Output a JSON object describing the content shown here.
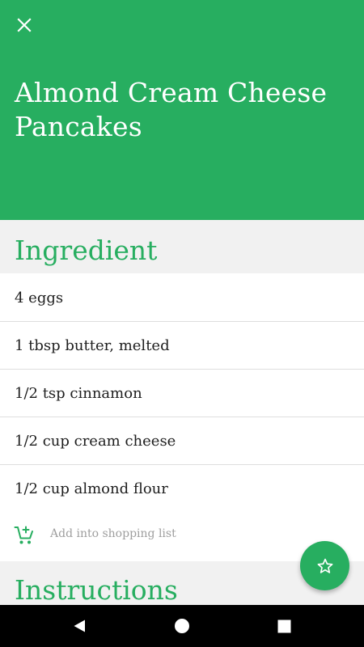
{
  "recipe": {
    "title": "Almond Cream Cheese Pancakes"
  },
  "sections": {
    "ingredient": "Ingredient",
    "instructions": "Instructions"
  },
  "ingredients": [
    "4 eggs",
    "1 tbsp butter, melted",
    "1/2 tsp cinnamon",
    "1/2 cup cream cheese",
    "1/2 cup almond flour"
  ],
  "shopping": {
    "label": "Add into shopping list"
  },
  "icons": {
    "close": "close-icon",
    "cart_add": "add-shopping-cart-icon",
    "favorite": "star-outline-icon",
    "back": "back-triangle-icon",
    "home": "home-circle-icon",
    "recents": "recents-square-icon"
  },
  "colors": {
    "primary": "#27ae60",
    "section_bg": "#f1f1f1",
    "text": "#1e1e1e",
    "muted": "#9e9e9e"
  }
}
